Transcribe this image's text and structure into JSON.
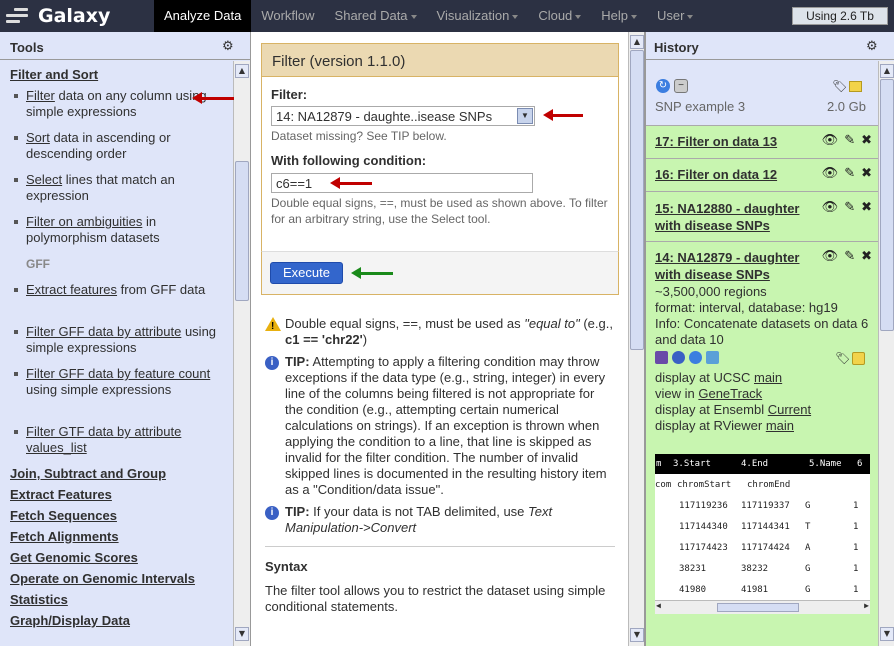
{
  "masthead": {
    "title": "Galaxy",
    "nav": [
      {
        "label": "Analyze Data",
        "dropdown": false,
        "active": true
      },
      {
        "label": "Workflow",
        "dropdown": false,
        "active": false
      },
      {
        "label": "Shared Data",
        "dropdown": true,
        "active": false
      },
      {
        "label": "Visualization",
        "dropdown": true,
        "active": false
      },
      {
        "label": "Cloud",
        "dropdown": true,
        "active": false
      },
      {
        "label": "Help",
        "dropdown": true,
        "active": false
      },
      {
        "label": "User",
        "dropdown": true,
        "active": false
      }
    ],
    "quota": "Using 2.6 Tb"
  },
  "tools": {
    "title": "Tools",
    "section_filter_sort": "Filter and Sort",
    "items": [
      {
        "link": "Filter",
        "rest": " data on any column using simple expressions"
      },
      {
        "link": "Sort",
        "rest": " data in ascending or descending order"
      },
      {
        "link": "Select",
        "rest": " lines that match an expression"
      },
      {
        "link": "Filter on ambiguities",
        "rest": " in polymorphism datasets"
      },
      {
        "link": "Extract features",
        "rest": " from GFF data"
      },
      {
        "link": "Filter GFF data by attribute",
        "rest": " using simple expressions"
      },
      {
        "link": "Filter GFF data by feature count",
        "rest": " using simple expressions"
      },
      {
        "link": "Filter GTF data by attribute values_list",
        "rest": ""
      }
    ],
    "gff_label": "GFF",
    "sections": [
      "Join, Subtract and Group",
      "Extract Features",
      "Fetch Sequences",
      "Fetch Alignments",
      "Get Genomic Scores",
      "Operate on Genomic Intervals",
      "Statistics",
      "Graph/Display Data"
    ]
  },
  "form": {
    "title": "Filter (version 1.1.0)",
    "filter_label": "Filter:",
    "filter_value": "14: NA12879 - daughte..isease SNPs",
    "filter_hint": "Dataset missing? See TIP below.",
    "condition_label": "With following condition:",
    "condition_value": "c6==1",
    "condition_hint": "Double equal signs, ==, must be used as shown above. To filter for an arbitrary string, use the Select tool.",
    "execute_label": "Execute"
  },
  "help": {
    "warn_text_1": "Double equal signs, ==, must be used as ",
    "warn_em": "\"equal to\"",
    "warn_text_2": " (e.g., ",
    "warn_code": "c1 == 'chr22'",
    "warn_text_3": ")",
    "tip1_label": "TIP:",
    "tip1_text": " Attempting to apply a filtering condition may throw exceptions if the data type (e.g., string, integer) in every line of the columns being filtered is not appropriate for the condition (e.g., attempting certain numerical calculations on strings). If an exception is thrown when applying the condition to a line, that line is skipped as invalid for the filter condition. The number of invalid skipped lines is documented in the resulting history item as a \"Condition/data issue\".",
    "tip2_label": "TIP:",
    "tip2_text": " If your data is not TAB delimited, use ",
    "tip2_em": "Text Manipulation->Convert",
    "syntax_heading": "Syntax",
    "syntax_text": "The filter tool allows you to restrict the dataset using simple conditional statements."
  },
  "history": {
    "title": "History",
    "name": "SNP example 3",
    "size": "2.0 Gb",
    "datasets": [
      {
        "title": "17: Filter on data 13"
      },
      {
        "title": "16: Filter on data 12"
      },
      {
        "title": "15: NA12880 - daughter with disease SNPs"
      },
      {
        "title": "14: NA12879 - daughter with disease SNPs"
      }
    ],
    "expanded": {
      "regions": "~3,500,000 regions",
      "format": "format: interval, database: hg19",
      "info": "Info: Concatenate datasets on data 6 and data 10",
      "display_ucsc": "display at UCSC ",
      "display_ucsc_link": "main",
      "view_in": "view in ",
      "view_in_link": "GeneTrack",
      "display_ensembl": "display at Ensembl ",
      "display_ensembl_link": "Current",
      "display_rviewer": "display at RViewer ",
      "display_rviewer_link": "main"
    },
    "peek": {
      "header": [
        "m",
        "3.Start",
        "4.End",
        "5.Name",
        "6"
      ],
      "subheader": [
        "com",
        "chromStart",
        "chromEnd"
      ],
      "rows": [
        [
          "117119236",
          "117119337",
          "G",
          "1"
        ],
        [
          "117144340",
          "117144341",
          "T",
          "1"
        ],
        [
          "117174423",
          "117174424",
          "A",
          "1"
        ],
        [
          "38231",
          "38232",
          "G",
          "1"
        ],
        [
          "41980",
          "41981",
          "G",
          "1"
        ]
      ]
    }
  },
  "colors": {
    "masthead": "#2c3143",
    "panel": "#dfe5f9",
    "ok_dataset": "#c8f5b0",
    "form_header": "#ebd9b2",
    "execute": "#3366cc",
    "red_arrow": "#c00000",
    "green_arrow": "#1a8a1a"
  }
}
